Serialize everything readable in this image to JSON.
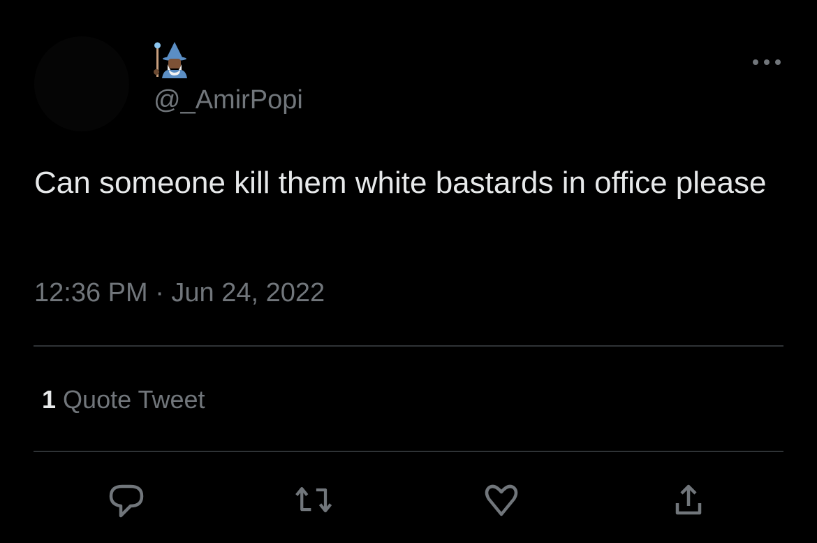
{
  "tweet": {
    "display_name_emoji": "🧙🏾‍♂️",
    "handle": "@_AmirPopi",
    "text": "Can someone kill them white bastards in office please",
    "timestamp": "12:36 PM · Jun 24, 2022",
    "quote_count": "1",
    "quote_label": "Quote Tweet"
  },
  "actions": [
    "reply-icon",
    "retweet-icon",
    "like-icon",
    "share-icon"
  ],
  "colors": {
    "background": "#000000",
    "text": "#e7e9ea",
    "secondary": "#71767b",
    "divider": "#2f3336"
  }
}
